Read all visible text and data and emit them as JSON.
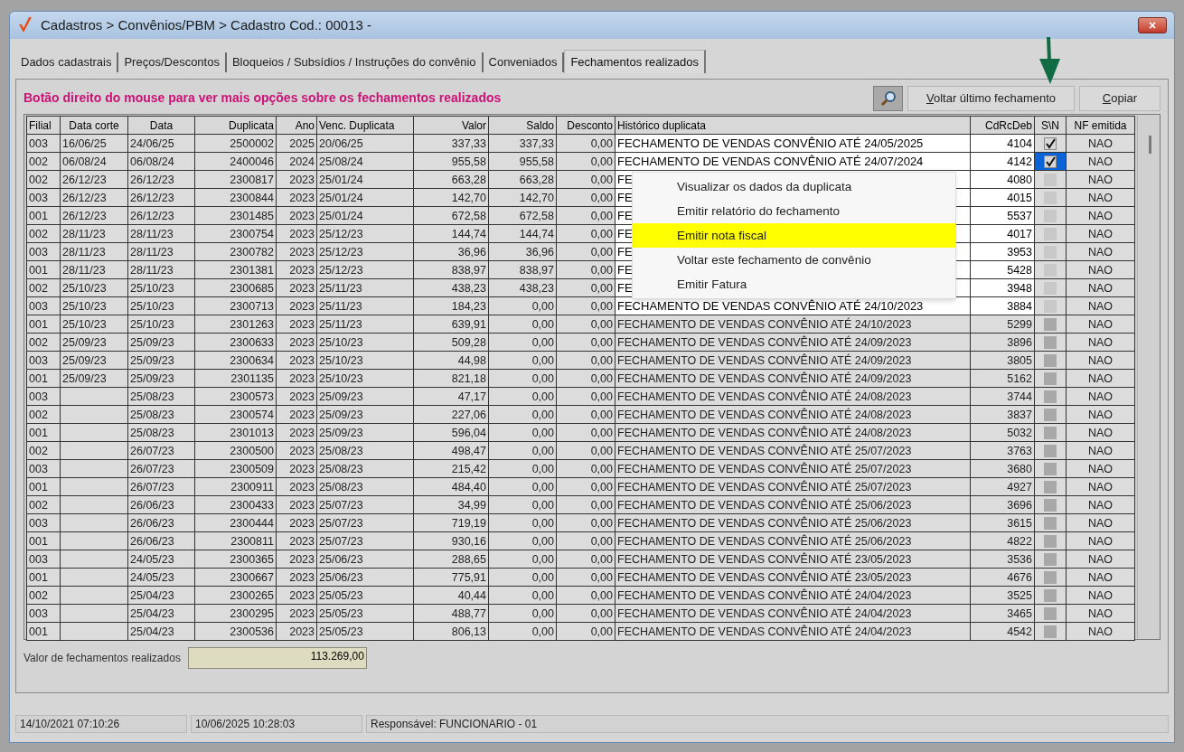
{
  "window": {
    "title": "Cadastros > Convênios/PBM > Cadastro  Cod.: 00013 -",
    "close": "×"
  },
  "tabs": [
    {
      "label": "Dados cadastrais",
      "selected": false
    },
    {
      "label": "Preços/Descontos",
      "selected": false
    },
    {
      "label": "Bloqueios / Subsídios / Instruções do convênio",
      "selected": false
    },
    {
      "label": "Conveniados",
      "selected": false
    },
    {
      "label": "Fechamentos realizados",
      "selected": true
    }
  ],
  "hint": "Botão direito do mouse para ver mais opções sobre os fechamentos realizados",
  "buttons": [
    "Voltar último fechamento",
    "Copiar"
  ],
  "table": {
    "columns": [
      "Filial",
      "Data corte",
      "Data",
      "Duplicata",
      "Ano",
      "Venc. Duplicata",
      "Valor",
      "Saldo",
      "Desconto",
      "Histórico duplicata",
      "CdRcDeb",
      "S\\N",
      "NF emitida"
    ],
    "rows": [
      {
        "filial": "003",
        "data_corte": "16/06/25",
        "data": "24/06/25",
        "duplicata": "2500002",
        "ano": "2025",
        "venc": "20/06/25",
        "valor": "337,33",
        "saldo": "337,33",
        "desconto": "0,00",
        "historico": "FECHAMENTO DE VENDAS CONVÊNIO ATÉ 24/05/2025",
        "cdrcdeb": "4104",
        "checked": true,
        "selected": false,
        "highlighted": true,
        "nf": "NAO"
      },
      {
        "filial": "002",
        "data_corte": "06/08/24",
        "data": "06/08/24",
        "duplicata": "2400046",
        "ano": "2024",
        "venc": "25/08/24",
        "valor": "955,58",
        "saldo": "955,58",
        "desconto": "0,00",
        "historico": "FECHAMENTO DE VENDAS CONVÊNIO ATÉ 24/07/2024",
        "cdrcdeb": "4142",
        "checked": true,
        "selected": true,
        "highlighted": true,
        "nf": "NAO"
      },
      {
        "filial": "002",
        "data_corte": "26/12/23",
        "data": "26/12/23",
        "duplicata": "2300817",
        "ano": "2023",
        "venc": "25/01/24",
        "valor": "663,28",
        "saldo": "663,28",
        "desconto": "0,00",
        "historico": "FE",
        "cdrcdeb": "4080",
        "checked": false,
        "selected": false,
        "highlighted": true,
        "nf": "NAO"
      },
      {
        "filial": "003",
        "data_corte": "26/12/23",
        "data": "26/12/23",
        "duplicata": "2300844",
        "ano": "2023",
        "venc": "25/01/24",
        "valor": "142,70",
        "saldo": "142,70",
        "desconto": "0,00",
        "historico": "FE",
        "cdrcdeb": "4015",
        "checked": false,
        "selected": false,
        "highlighted": true,
        "nf": "NAO"
      },
      {
        "filial": "001",
        "data_corte": "26/12/23",
        "data": "26/12/23",
        "duplicata": "2301485",
        "ano": "2023",
        "venc": "25/01/24",
        "valor": "672,58",
        "saldo": "672,58",
        "desconto": "0,00",
        "historico": "FE",
        "cdrcdeb": "5537",
        "checked": false,
        "selected": false,
        "highlighted": true,
        "nf": "NAO"
      },
      {
        "filial": "002",
        "data_corte": "28/11/23",
        "data": "28/11/23",
        "duplicata": "2300754",
        "ano": "2023",
        "venc": "25/12/23",
        "valor": "144,74",
        "saldo": "144,74",
        "desconto": "0,00",
        "historico": "FE",
        "cdrcdeb": "4017",
        "checked": false,
        "selected": false,
        "highlighted": true,
        "nf": "NAO"
      },
      {
        "filial": "003",
        "data_corte": "28/11/23",
        "data": "28/11/23",
        "duplicata": "2300782",
        "ano": "2023",
        "venc": "25/12/23",
        "valor": "36,96",
        "saldo": "36,96",
        "desconto": "0,00",
        "historico": "FE",
        "cdrcdeb": "3953",
        "checked": false,
        "selected": false,
        "highlighted": true,
        "nf": "NAO"
      },
      {
        "filial": "001",
        "data_corte": "28/11/23",
        "data": "28/11/23",
        "duplicata": "2301381",
        "ano": "2023",
        "venc": "25/12/23",
        "valor": "838,97",
        "saldo": "838,97",
        "desconto": "0,00",
        "historico": "FE",
        "cdrcdeb": "5428",
        "checked": false,
        "selected": false,
        "highlighted": true,
        "nf": "NAO"
      },
      {
        "filial": "002",
        "data_corte": "25/10/23",
        "data": "25/10/23",
        "duplicata": "2300685",
        "ano": "2023",
        "venc": "25/11/23",
        "valor": "438,23",
        "saldo": "438,23",
        "desconto": "0,00",
        "historico": "FE",
        "cdrcdeb": "3948",
        "checked": false,
        "selected": false,
        "highlighted": true,
        "nf": "NAO"
      },
      {
        "filial": "003",
        "data_corte": "25/10/23",
        "data": "25/10/23",
        "duplicata": "2300713",
        "ano": "2023",
        "venc": "25/11/23",
        "valor": "184,23",
        "saldo": "0,00",
        "desconto": "0,00",
        "historico": "FECHAMENTO DE VENDAS CONVÊNIO ATÉ 24/10/2023",
        "cdrcdeb": "3884",
        "checked": false,
        "selected": false,
        "highlighted": true,
        "nf": "NAO"
      },
      {
        "filial": "001",
        "data_corte": "25/10/23",
        "data": "25/10/23",
        "duplicata": "2301263",
        "ano": "2023",
        "venc": "25/11/23",
        "valor": "639,91",
        "saldo": "0,00",
        "desconto": "0,00",
        "historico": "FECHAMENTO DE VENDAS CONVÊNIO ATÉ 24/10/2023",
        "cdrcdeb": "5299",
        "checked": false,
        "selected": false,
        "highlighted": false,
        "nf": "NAO"
      },
      {
        "filial": "002",
        "data_corte": "25/09/23",
        "data": "25/09/23",
        "duplicata": "2300633",
        "ano": "2023",
        "venc": "25/10/23",
        "valor": "509,28",
        "saldo": "0,00",
        "desconto": "0,00",
        "historico": "FECHAMENTO DE VENDAS CONVÊNIO ATÉ 24/09/2023",
        "cdrcdeb": "3896",
        "checked": false,
        "selected": false,
        "highlighted": false,
        "nf": "NAO"
      },
      {
        "filial": "003",
        "data_corte": "25/09/23",
        "data": "25/09/23",
        "duplicata": "2300634",
        "ano": "2023",
        "venc": "25/10/23",
        "valor": "44,98",
        "saldo": "0,00",
        "desconto": "0,00",
        "historico": "FECHAMENTO DE VENDAS CONVÊNIO ATÉ 24/09/2023",
        "cdrcdeb": "3805",
        "checked": false,
        "selected": false,
        "highlighted": false,
        "nf": "NAO"
      },
      {
        "filial": "001",
        "data_corte": "25/09/23",
        "data": "25/09/23",
        "duplicata": "2301135",
        "ano": "2023",
        "venc": "25/10/23",
        "valor": "821,18",
        "saldo": "0,00",
        "desconto": "0,00",
        "historico": "FECHAMENTO DE VENDAS CONVÊNIO ATÉ 24/09/2023",
        "cdrcdeb": "5162",
        "checked": false,
        "selected": false,
        "highlighted": false,
        "nf": "NAO"
      },
      {
        "filial": "003",
        "data": "25/08/23",
        "duplicata": "2300573",
        "ano": "2023",
        "venc": "25/09/23",
        "valor": "47,17",
        "saldo": "0,00",
        "desconto": "0,00",
        "historico": "FECHAMENTO DE VENDAS CONVÊNIO ATÉ 24/08/2023",
        "cdrcdeb": "3744",
        "checked": false,
        "selected": false,
        "highlighted": false,
        "nf": "NAO"
      },
      {
        "filial": "002",
        "data": "25/08/23",
        "duplicata": "2300574",
        "ano": "2023",
        "venc": "25/09/23",
        "valor": "227,06",
        "saldo": "0,00",
        "desconto": "0,00",
        "historico": "FECHAMENTO DE VENDAS CONVÊNIO ATÉ 24/08/2023",
        "cdrcdeb": "3837",
        "checked": false,
        "selected": false,
        "highlighted": false,
        "nf": "NAO"
      },
      {
        "filial": "001",
        "data": "25/08/23",
        "duplicata": "2301013",
        "ano": "2023",
        "venc": "25/09/23",
        "valor": "596,04",
        "saldo": "0,00",
        "desconto": "0,00",
        "historico": "FECHAMENTO DE VENDAS CONVÊNIO ATÉ 24/08/2023",
        "cdrcdeb": "5032",
        "checked": false,
        "selected": false,
        "highlighted": false,
        "nf": "NAO"
      },
      {
        "filial": "002",
        "data": "26/07/23",
        "duplicata": "2300500",
        "ano": "2023",
        "venc": "25/08/23",
        "valor": "498,47",
        "saldo": "0,00",
        "desconto": "0,00",
        "historico": "FECHAMENTO DE VENDAS CONVÊNIO ATÉ 25/07/2023",
        "cdrcdeb": "3763",
        "checked": false,
        "selected": false,
        "highlighted": false,
        "nf": "NAO"
      },
      {
        "filial": "003",
        "data": "26/07/23",
        "duplicata": "2300509",
        "ano": "2023",
        "venc": "25/08/23",
        "valor": "215,42",
        "saldo": "0,00",
        "desconto": "0,00",
        "historico": "FECHAMENTO DE VENDAS CONVÊNIO ATÉ 25/07/2023",
        "cdrcdeb": "3680",
        "checked": false,
        "selected": false,
        "highlighted": false,
        "nf": "NAO"
      },
      {
        "filial": "001",
        "data": "26/07/23",
        "duplicata": "2300911",
        "ano": "2023",
        "venc": "25/08/23",
        "valor": "484,40",
        "saldo": "0,00",
        "desconto": "0,00",
        "historico": "FECHAMENTO DE VENDAS CONVÊNIO ATÉ 25/07/2023",
        "cdrcdeb": "4927",
        "checked": false,
        "selected": false,
        "highlighted": false,
        "nf": "NAO"
      },
      {
        "filial": "002",
        "data": "26/06/23",
        "duplicata": "2300433",
        "ano": "2023",
        "venc": "25/07/23",
        "valor": "34,99",
        "saldo": "0,00",
        "desconto": "0,00",
        "historico": "FECHAMENTO DE VENDAS CONVÊNIO ATÉ 25/06/2023",
        "cdrcdeb": "3696",
        "checked": false,
        "selected": false,
        "highlighted": false,
        "nf": "NAO"
      },
      {
        "filial": "003",
        "data": "26/06/23",
        "duplicata": "2300444",
        "ano": "2023",
        "venc": "25/07/23",
        "valor": "719,19",
        "saldo": "0,00",
        "desconto": "0,00",
        "historico": "FECHAMENTO DE VENDAS CONVÊNIO ATÉ 25/06/2023",
        "cdrcdeb": "3615",
        "checked": false,
        "selected": false,
        "highlighted": false,
        "nf": "NAO"
      },
      {
        "filial": "001",
        "data": "26/06/23",
        "duplicata": "2300811",
        "ano": "2023",
        "venc": "25/07/23",
        "valor": "930,16",
        "saldo": "0,00",
        "desconto": "0,00",
        "historico": "FECHAMENTO DE VENDAS CONVÊNIO ATÉ 25/06/2023",
        "cdrcdeb": "4822",
        "checked": false,
        "selected": false,
        "highlighted": false,
        "nf": "NAO"
      },
      {
        "filial": "003",
        "data": "24/05/23",
        "duplicata": "2300365",
        "ano": "2023",
        "venc": "25/06/23",
        "valor": "288,65",
        "saldo": "0,00",
        "desconto": "0,00",
        "historico": "FECHAMENTO DE VENDAS CONVÊNIO ATÉ 23/05/2023",
        "cdrcdeb": "3536",
        "checked": false,
        "selected": false,
        "highlighted": false,
        "nf": "NAO"
      },
      {
        "filial": "001",
        "data": "24/05/23",
        "duplicata": "2300667",
        "ano": "2023",
        "venc": "25/06/23",
        "valor": "775,91",
        "saldo": "0,00",
        "desconto": "0,00",
        "historico": "FECHAMENTO DE VENDAS CONVÊNIO ATÉ 23/05/2023",
        "cdrcdeb": "4676",
        "checked": false,
        "selected": false,
        "highlighted": false,
        "nf": "NAO"
      },
      {
        "filial": "002",
        "data": "25/04/23",
        "duplicata": "2300265",
        "ano": "2023",
        "venc": "25/05/23",
        "valor": "40,44",
        "saldo": "0,00",
        "desconto": "0,00",
        "historico": "FECHAMENTO DE VENDAS CONVÊNIO ATÉ 24/04/2023",
        "cdrcdeb": "3525",
        "checked": false,
        "selected": false,
        "highlighted": false,
        "nf": "NAO"
      },
      {
        "filial": "003",
        "data": "25/04/23",
        "duplicata": "2300295",
        "ano": "2023",
        "venc": "25/05/23",
        "valor": "488,77",
        "saldo": "0,00",
        "desconto": "0,00",
        "historico": "FECHAMENTO DE VENDAS CONVÊNIO ATÉ 24/04/2023",
        "cdrcdeb": "3465",
        "checked": false,
        "selected": false,
        "highlighted": false,
        "nf": "NAO"
      },
      {
        "filial": "001",
        "data": "25/04/23",
        "duplicata": "2300536",
        "ano": "2023",
        "venc": "25/05/23",
        "valor": "806,13",
        "saldo": "0,00",
        "desconto": "0,00",
        "historico": "FECHAMENTO DE VENDAS CONVÊNIO ATÉ 24/04/2023",
        "cdrcdeb": "4542",
        "checked": false,
        "selected": false,
        "highlighted": false,
        "nf": "NAO"
      }
    ]
  },
  "context_menu": [
    {
      "label": "Visualizar os dados da duplicata",
      "selected": false
    },
    {
      "label": "Emitir relatório do fechamento",
      "selected": false
    },
    {
      "label": "Emitir nota fiscal",
      "selected": true
    },
    {
      "label": "Voltar este fechamento de convênio",
      "selected": false
    },
    {
      "label": "Emitir Fatura",
      "selected": false
    }
  ],
  "total": {
    "label": "Valor de fechamentos realizados",
    "value": "113.269,00"
  },
  "status_bar": [
    "14/10/2021 07:10:26",
    "10/06/2025 10:28:03",
    "Responsável: FUNCIONARIO - 01"
  ]
}
